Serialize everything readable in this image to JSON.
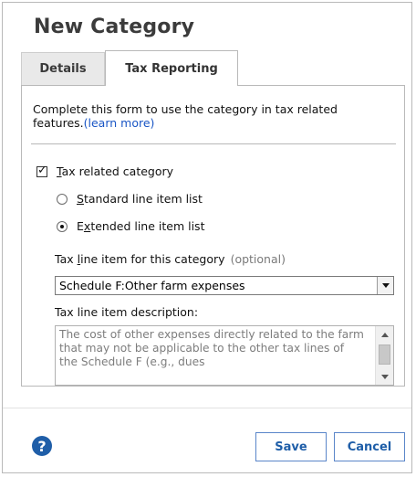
{
  "dialog": {
    "title": "New Category",
    "tabs": [
      {
        "label": "Details",
        "active": false
      },
      {
        "label": "Tax Reporting",
        "active": true
      }
    ],
    "intro_text": "Complete this form to use the category in tax related features.",
    "learn_more": "(learn more)",
    "tax_related": {
      "pre": "",
      "u": "T",
      "post": "ax related category",
      "checked": true
    },
    "radio_standard": {
      "pre": "",
      "u": "S",
      "post": "tandard line item list",
      "selected": false
    },
    "radio_extended": {
      "pre": "E",
      "u": "x",
      "post": "tended line item list",
      "selected": true
    },
    "tax_line_label": {
      "pre": "Tax ",
      "u": "l",
      "post": "ine item for this category"
    },
    "optional": "(optional)",
    "tax_line_value": "Schedule F:Other farm expenses",
    "description_label": "Tax line item description:",
    "description_text": "The cost of other expenses directly related to the farm that may not be applicable to the other tax lines of the Schedule F (e.g., dues",
    "buttons": {
      "help": "?",
      "save": "Save",
      "cancel": "Cancel"
    },
    "colors": {
      "accent": "#1f5ea8",
      "link": "#1a56c5"
    }
  }
}
